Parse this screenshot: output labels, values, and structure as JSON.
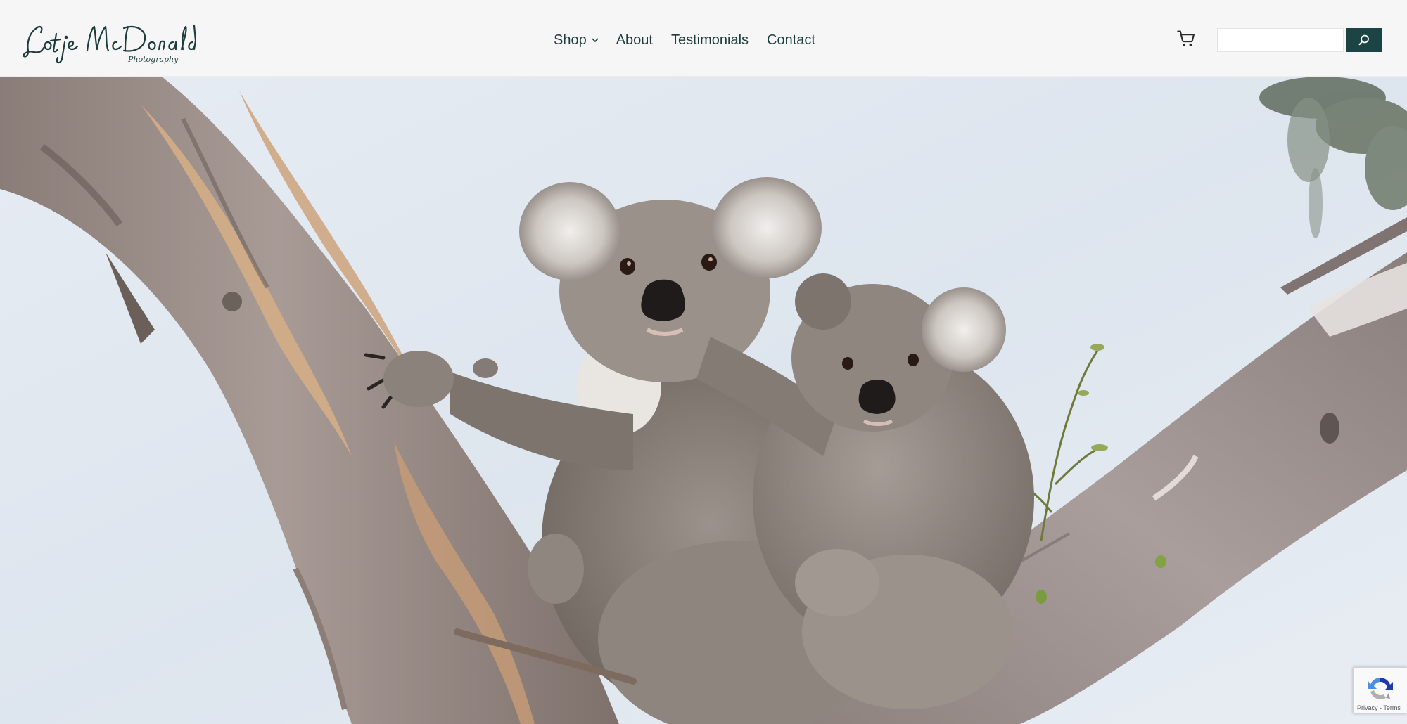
{
  "header": {
    "logo": {
      "name_text": "Lotje McDonald",
      "tagline_text": "Photography",
      "color": "#1d3c3c"
    },
    "nav": {
      "shop_label": "Shop",
      "about_label": "About",
      "testimonials_label": "Testimonials",
      "contact_label": "Contact"
    },
    "cart_icon": "shopping-cart-icon",
    "search": {
      "placeholder": "",
      "value": "",
      "button_icon": "search-icon",
      "button_color": "#1c4444"
    }
  },
  "hero": {
    "subject": "koala-mother-and-joey-in-gum-tree"
  },
  "recaptcha": {
    "privacy_label": "Privacy",
    "separator": " - ",
    "terms_label": "Terms"
  },
  "colors": {
    "header_bg": "#f6f6f6",
    "nav_text": "#1d3c3c",
    "accent": "#1c4444",
    "sky": "#dfe6ee"
  }
}
